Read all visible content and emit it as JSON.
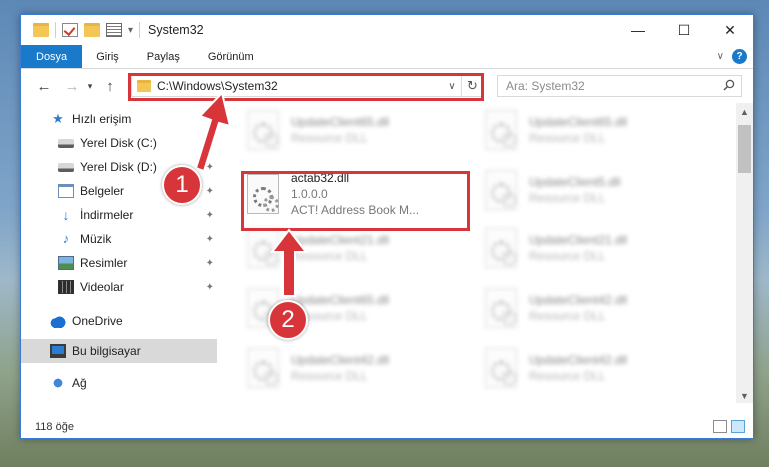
{
  "window": {
    "title": "System32",
    "controls": {
      "minimize": "—",
      "maximize": "☐",
      "close": "✕"
    }
  },
  "ribbon": {
    "tabs": [
      {
        "label": "Dosya",
        "active": true
      },
      {
        "label": "Giriş",
        "active": false
      },
      {
        "label": "Paylaş",
        "active": false
      },
      {
        "label": "Görünüm",
        "active": false
      }
    ]
  },
  "nav": {
    "address": "C:\\Windows\\System32",
    "search_placeholder": "Ara: System32"
  },
  "sidebar": {
    "items": [
      {
        "label": "Hızlı erişim",
        "icon": "star-icon",
        "pinned": false
      },
      {
        "label": "Yerel Disk (C:)",
        "icon": "drive-icon",
        "pinned": true
      },
      {
        "label": "Yerel Disk (D:)",
        "icon": "drive-icon",
        "pinned": true
      },
      {
        "label": "Belgeler",
        "icon": "documents-icon",
        "pinned": true
      },
      {
        "label": "İndirmeler",
        "icon": "downloads-icon",
        "pinned": true
      },
      {
        "label": "Müzik",
        "icon": "music-icon",
        "pinned": true
      },
      {
        "label": "Resimler",
        "icon": "pictures-icon",
        "pinned": true
      },
      {
        "label": "Videolar",
        "icon": "videos-icon",
        "pinned": true
      },
      {
        "label": "OneDrive",
        "icon": "onedrive-icon",
        "pinned": false
      },
      {
        "label": "Bu bilgisayar",
        "icon": "this-pc-icon",
        "pinned": false
      },
      {
        "label": "Ağ",
        "icon": "network-icon",
        "pinned": false
      }
    ]
  },
  "files": [
    {
      "name": "UpdateClient65.dll",
      "type": "Resource DLL"
    },
    {
      "name": "UpdateClient65.dll",
      "type": "Resource DLL"
    },
    {
      "name": "actab32.dll",
      "version": "1.0.0.0",
      "description": "ACT! Address Book M..."
    },
    {
      "name": "UpdateClient5.dll",
      "type": "Resource DLL"
    },
    {
      "name": "UpdateClient21.dll",
      "type": "Resource DLL"
    },
    {
      "name": "UpdateClient21.dll",
      "type": "Resource DLL"
    },
    {
      "name": "UpdateClient65.dll",
      "type": "Resource DLL"
    },
    {
      "name": "UpdateClient42.dll",
      "type": "Resource DLL"
    },
    {
      "name": "UpdateClient42.dll",
      "type": "Resource DLL"
    },
    {
      "name": "UpdateClient42.dll",
      "type": "Resource DLL"
    }
  ],
  "status": {
    "item_count": "118 öğe"
  },
  "annotations": {
    "step1": "1",
    "step2": "2",
    "color": "#d8353a"
  }
}
